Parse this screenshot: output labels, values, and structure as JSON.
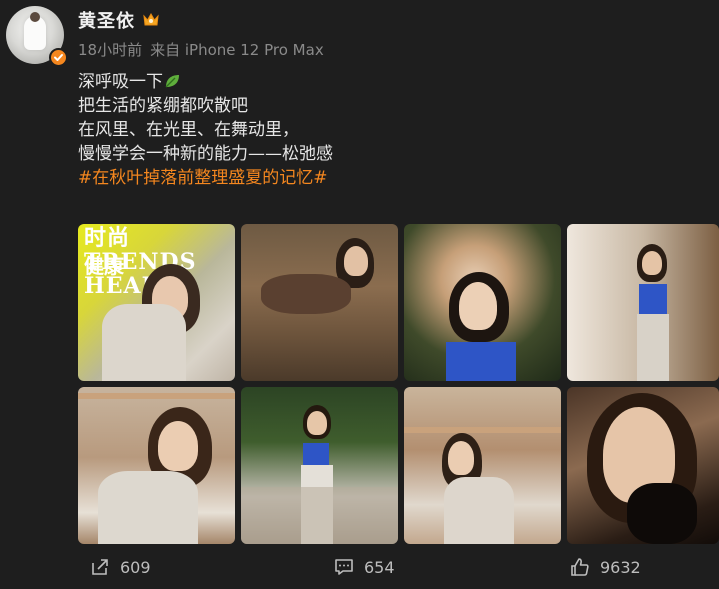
{
  "post": {
    "author": "黄圣依",
    "time": "18小时前",
    "source": "来自 iPhone 12 Pro Max",
    "lines": [
      "深呼吸一下",
      "把生活的紧绷都吹散吧",
      "在风里、在光里、在舞动里，",
      "慢慢学会一种新的能力——松弛感"
    ],
    "hashtag": "#在秋叶掉落前整理盛夏的记忆#"
  },
  "images": {
    "magazine_title": "时尚TRENDS HEALTH",
    "magazine_sub": "健康"
  },
  "actions": {
    "share_count": "609",
    "comment_count": "654",
    "like_count": "9632"
  },
  "colors": {
    "accent": "#f5871f",
    "background": "#1e1e1e",
    "text": "#e6e6e6",
    "muted": "#8a8a8a"
  },
  "icons": [
    "verified-badge-icon",
    "member-crown-icon",
    "leaf-emoji-icon",
    "share-icon",
    "comment-icon",
    "like-icon"
  ]
}
